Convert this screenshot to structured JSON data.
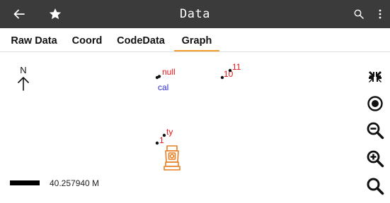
{
  "app_bar": {
    "title": "Data",
    "back_icon": "arrow-left-icon",
    "favorite_icon": "star-icon",
    "search_icon": "search-icon",
    "menu_icon": "more-vert-icon",
    "background": "#3b3b3b"
  },
  "tabs": [
    {
      "label": "Raw Data",
      "active": false
    },
    {
      "label": "Coord",
      "active": false
    },
    {
      "label": "CodeData",
      "active": false
    },
    {
      "label": "Graph",
      "active": true
    }
  ],
  "accent": "#f0a030",
  "graph": {
    "north_label": "N",
    "points": [
      {
        "label": "null",
        "color": "#e8161a"
      },
      {
        "label": "cal",
        "color": "#2b2bd8"
      },
      {
        "label": "10",
        "color": "#e8161a"
      },
      {
        "label": "11",
        "color": "#e8161a"
      },
      {
        "label": "ty",
        "color": "#e8161a"
      },
      {
        "label": "1",
        "color": "#e8161a"
      }
    ],
    "instrument_icon": "total-station-icon",
    "scale_label": "40.257940 M"
  },
  "tools": [
    {
      "icon": "collapse-icon"
    },
    {
      "icon": "locate-icon"
    },
    {
      "icon": "zoom-out-icon"
    },
    {
      "icon": "zoom-in-icon"
    },
    {
      "icon": "search-icon"
    }
  ]
}
